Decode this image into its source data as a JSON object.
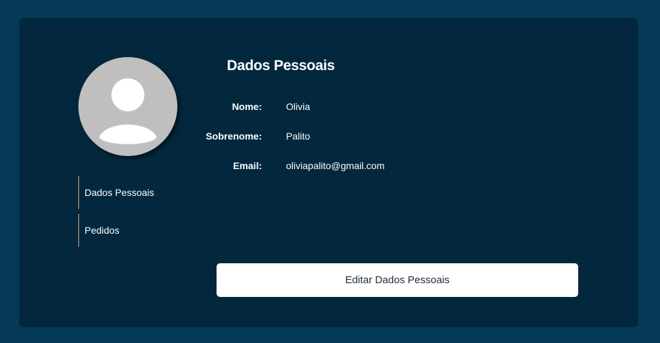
{
  "profile": {
    "title": "Dados Pessoais",
    "avatar_icon": "user-avatar-icon",
    "fields": [
      {
        "label": "Nome:",
        "value": "Olivia"
      },
      {
        "label": "Sobrenome:",
        "value": "Palito"
      },
      {
        "label": "Email:",
        "value": "oliviapalito@gmail.com"
      }
    ],
    "edit_button_label": "Editar Dados Pessoais"
  },
  "side_nav": {
    "items": [
      {
        "label": "Dados Pessoais"
      },
      {
        "label": "Pedidos"
      }
    ]
  },
  "colors": {
    "page_background": "#053a58",
    "card_background": "#03283e",
    "nav_accent": "#d9a87f",
    "avatar_background": "#bfbfbf"
  }
}
